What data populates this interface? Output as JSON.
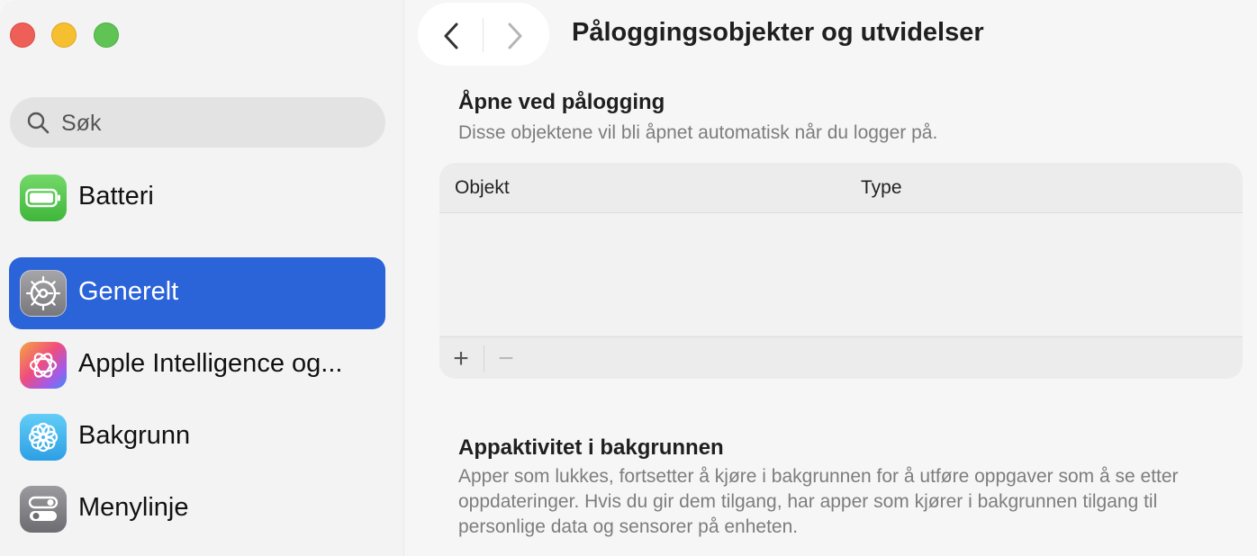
{
  "window": {
    "title": "Påloggingsobjekter og utvidelser"
  },
  "sidebar": {
    "search": {
      "placeholder": "Søk",
      "value": ""
    },
    "items": [
      {
        "label": "Batteri",
        "icon": "battery-icon",
        "selected": false
      },
      {
        "label": "Generelt",
        "icon": "gear-icon",
        "selected": true
      },
      {
        "label": "Apple Intelligence og...",
        "icon": "apple-intelligence-icon",
        "selected": false
      },
      {
        "label": "Bakgrunn",
        "icon": "wallpaper-flower-icon",
        "selected": false
      },
      {
        "label": "Menylinje",
        "icon": "menu-bar-toggle-icon",
        "selected": false
      }
    ]
  },
  "login_items": {
    "title": "Åpne ved pålogging",
    "description": "Disse objektene vil bli åpnet automatisk når du logger på.",
    "columns": [
      "Objekt",
      "Type"
    ],
    "rows": [],
    "add_label": "+",
    "remove_label": "−"
  },
  "background": {
    "title": "Appaktivitet i bakgrunnen",
    "description": "Apper som lukkes, fortsetter å kjøre i bakgrunnen for å utføre oppgaver som å se etter oppdateringer. Hvis du gir dem tilgang, har apper som kjører i bakgrunnen tilgang til personlige data og sensorer på enheten."
  },
  "colors": {
    "accent": "#2b63d9",
    "close": "#ee5f57",
    "minimize": "#f6bf2f",
    "maximize": "#5fc454"
  }
}
